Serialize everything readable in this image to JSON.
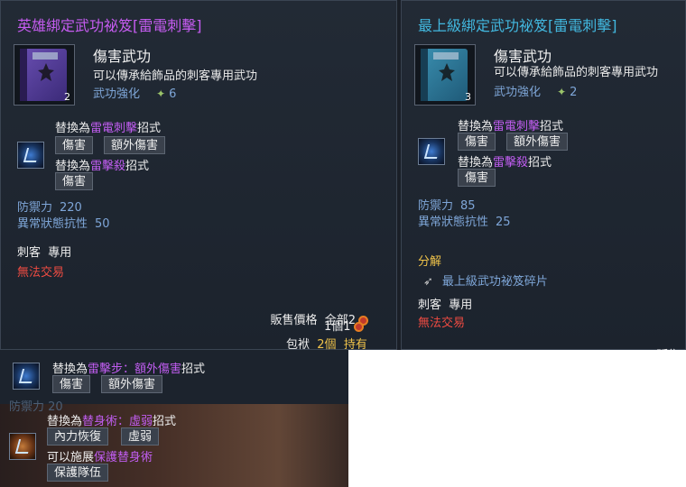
{
  "left": {
    "title": "英雄綁定武功祕笈[雷電刺擊]",
    "stack": "2",
    "item_name": "傷害武功",
    "item_desc": "可以傳承給飾品的刺客專用武功",
    "enhance_label": "武功強化",
    "enhance_value": "6",
    "skill1_prefix": "替換為",
    "skill1_name": "雷電刺擊",
    "skill1_suffix": "招式",
    "skill1_tags": [
      "傷害",
      "額外傷害"
    ],
    "skill2_prefix": "替換為",
    "skill2_name": "雷擊殺",
    "skill2_suffix": "招式",
    "skill2_tags": [
      "傷害"
    ],
    "stat_def_label": "防禦力",
    "stat_def_value": "220",
    "stat_res_label": "異常狀態抗性",
    "stat_res_value": "50",
    "class_req": "刺客  專用",
    "untradable": "無法交易",
    "sell_label": "販售價格  全部2",
    "sell_unit": "1個1",
    "bag_label": "包袱",
    "bag_count": "2個",
    "bag_own": "持有"
  },
  "right": {
    "title": "最上級綁定武功祕笈[雷電刺擊]",
    "stack": "3",
    "item_name": "傷害武功",
    "item_desc": "可以傳承給飾品的刺客專用武功",
    "enhance_label": "武功強化",
    "enhance_value": "2",
    "skill1_prefix": "替換為",
    "skill1_name": "雷電刺擊",
    "skill1_suffix": "招式",
    "skill1_tags": [
      "傷害",
      "額外傷害"
    ],
    "skill2_prefix": "替換為",
    "skill2_name": "雷擊殺",
    "skill2_suffix": "招式",
    "skill2_tags": [
      "傷害"
    ],
    "stat_def_label": "防禦力",
    "stat_def_value": "85",
    "stat_res_label": "異常狀態抗性",
    "stat_res_value": "25",
    "decompose": "分解",
    "shard": "最上級武功祕笈碎片",
    "class_req": "刺客  專用",
    "untradable": "無法交易",
    "cut_text": "販售"
  },
  "bottom": {
    "s1_prefix": "替換為",
    "s1_name": "雷擊步：額外傷害",
    "s1_suffix": "招式",
    "s1_tags": [
      "傷害",
      "額外傷害"
    ],
    "faded": "防禦力  20",
    "s2_prefix": "替換為",
    "s2_name": "替身術：虛弱",
    "s2_suffix": "招式",
    "s2_tags": [
      "內力恢復",
      "虛弱"
    ],
    "s3_prefix": "可以施展",
    "s3_name": "保護替身術",
    "s3_tags": [
      "保護隊伍"
    ]
  },
  "colors": {
    "purple": "#c65cf1",
    "cyan": "#42b8df",
    "blue_text": "#7ea6d8",
    "red": "#ee4b42",
    "gold": "#f0c34a"
  },
  "icons": {
    "book": "book-icon",
    "skill": "lightning-skill-icon",
    "coin": "coin-icon",
    "feather": "feather-icon",
    "spark": "spark-icon"
  }
}
